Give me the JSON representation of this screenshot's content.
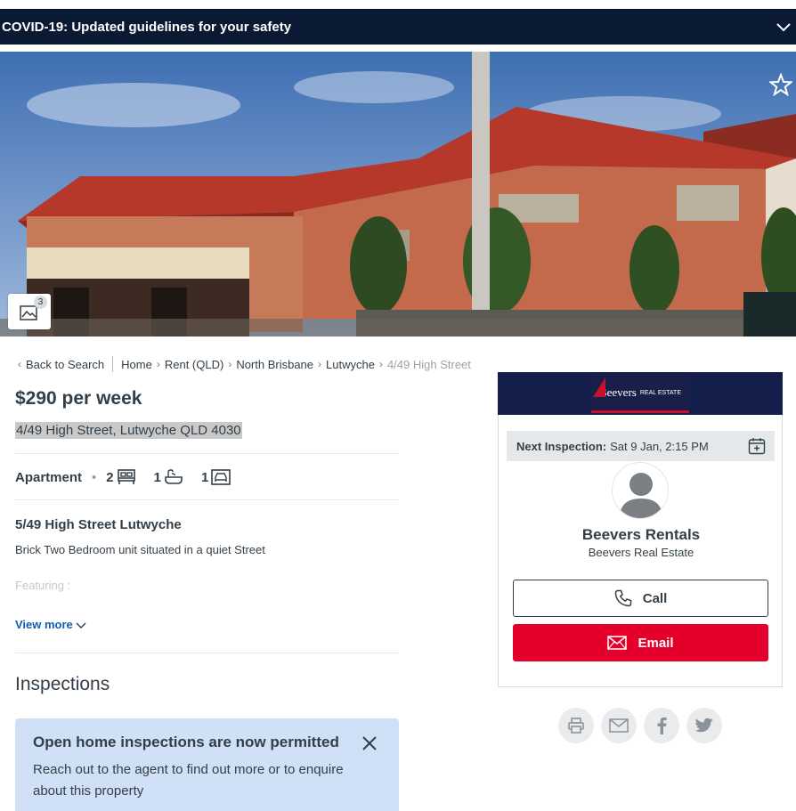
{
  "covid_banner": {
    "text": "COVID-19: Updated guidelines for your safety",
    "icon": "chevron-down-icon"
  },
  "gallery": {
    "photo_count": "3",
    "icon": "image-gallery-icon"
  },
  "favourite": {
    "icon": "star-icon"
  },
  "breadcrumb": {
    "back": "Back to Search",
    "items": [
      "Home",
      "Rent (QLD)",
      "North Brisbane",
      "Lutwyche"
    ],
    "current": "4/49 High Street"
  },
  "listing": {
    "price": "$290 per week",
    "address": "4/49 High Street, Lutwyche QLD 4030",
    "property_type": "Apartment",
    "beds": "2",
    "baths": "1",
    "parking": "1"
  },
  "description": {
    "title": "5/49 High Street Lutwyche",
    "text": "Brick Two Bedroom unit situated in a quiet Street",
    "faded": "Featuring :",
    "view_more": "View more"
  },
  "inspections": {
    "heading": "Inspections",
    "notice_title": "Open home inspections are now permitted",
    "notice_body": "Reach out to the agent to find out more or to enquire about this property"
  },
  "agent": {
    "logo_text": "Beevers",
    "logo_small": "REAL ESTATE",
    "next_inspection_label": "Next Inspection:",
    "next_inspection_value": "Sat 9 Jan, 2:15 PM",
    "name": "Beevers Rentals",
    "agency": "Beevers Real Estate",
    "call_label": "Call",
    "email_label": "Email"
  },
  "colors": {
    "banner": "#0b1a33",
    "email_button": "#e4002b",
    "notice_bg": "#cfe0f7",
    "link": "#0d5eb4"
  }
}
